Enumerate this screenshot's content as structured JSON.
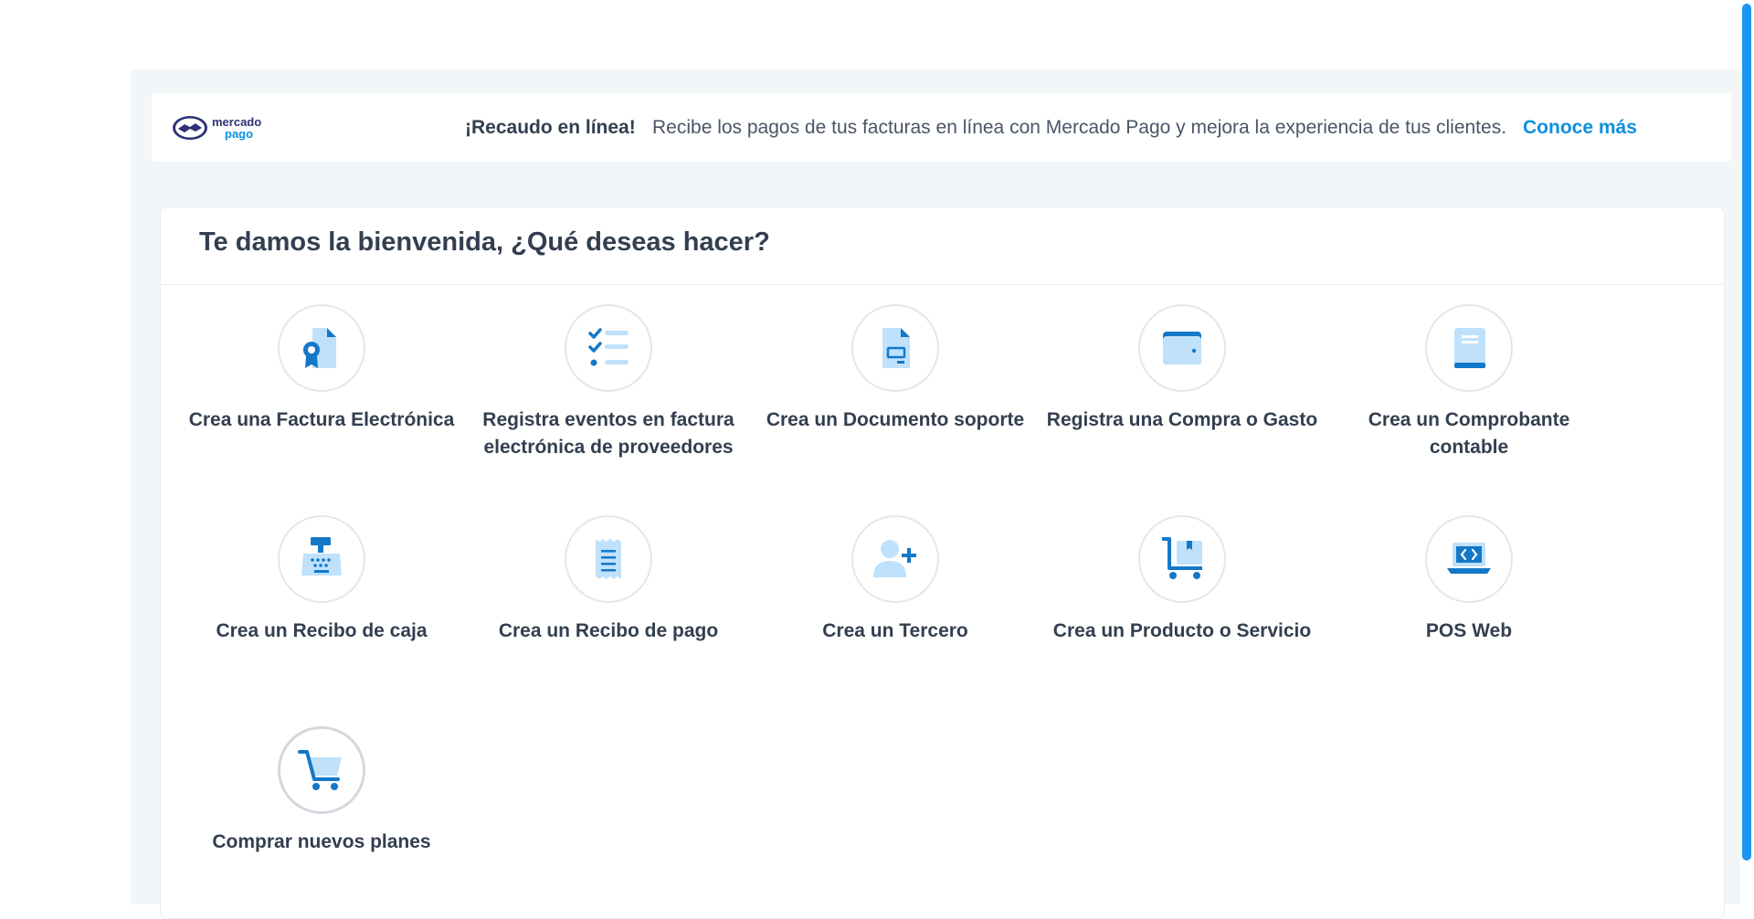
{
  "banner": {
    "logo_line1": "mercado",
    "logo_line2": "pago",
    "title": "¡Recaudo en línea!",
    "text": "Recibe los pagos de tus facturas en línea con Mercado Pago y mejora la experiencia de tus clientes.",
    "link": "Conoce más"
  },
  "welcome": {
    "title": "Te damos la bienvenida, ¿Qué deseas hacer?"
  },
  "actions": [
    {
      "label": "Crea una Factura Electrónica",
      "icon": "electronic-invoice-icon"
    },
    {
      "label": "Registra eventos en factura electrónica de proveedores",
      "icon": "checklist-icon"
    },
    {
      "label": "Crea un Documento soporte",
      "icon": "support-document-icon"
    },
    {
      "label": "Registra una Compra o Gasto",
      "icon": "wallet-icon"
    },
    {
      "label": "Crea un Comprobante contable",
      "icon": "ledger-book-icon"
    },
    {
      "label": "Crea un Recibo de caja",
      "icon": "cash-register-icon"
    },
    {
      "label": "Crea un Recibo de pago",
      "icon": "receipt-icon"
    },
    {
      "label": "Crea un Tercero",
      "icon": "add-user-icon"
    },
    {
      "label": "Crea un Producto o Servicio",
      "icon": "product-cart-icon"
    },
    {
      "label": "POS Web",
      "icon": "laptop-code-icon"
    },
    {
      "label": "Comprar nuevos planes",
      "icon": "shopping-cart-icon"
    }
  ],
  "colors": {
    "accent": "#0c8fe0",
    "icon_dark": "#1478c8",
    "icon_light": "#bfe1fb",
    "text": "#333f50",
    "background": "#f3f6f9"
  }
}
